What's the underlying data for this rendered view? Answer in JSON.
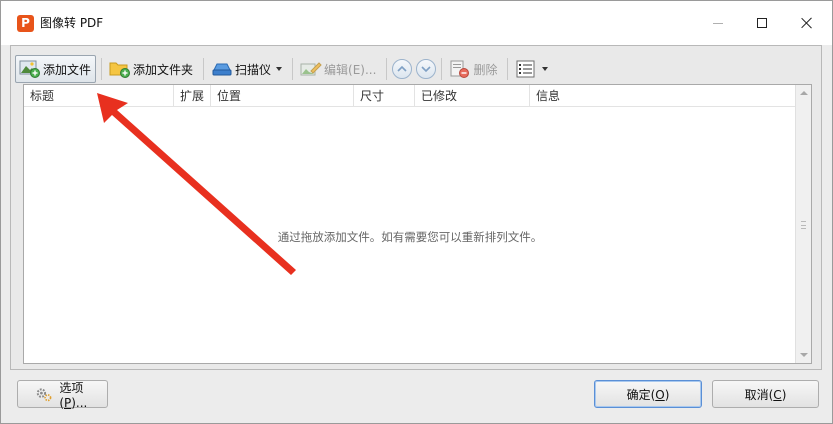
{
  "window": {
    "title": "图像转 PDF",
    "logo_letter": "P",
    "colors": {
      "logo": "#e8541a",
      "annotation_arrow": "#e8301f",
      "primary_border": "#5a8fd6"
    }
  },
  "toolbar": {
    "add_file": "添加文件",
    "add_folder": "添加文件夹",
    "scanner": "扫描仪",
    "edit": "编辑(E)...",
    "move_up_icon": "chevron-up-icon",
    "move_down_icon": "chevron-down-icon",
    "delete": "删除",
    "view_icon": "list-view-icon"
  },
  "list": {
    "columns": [
      "标题",
      "扩展",
      "位置",
      "尺寸",
      "已修改",
      "信息"
    ],
    "empty_message": "通过拖放添加文件。如有需要您可以重新排列文件。"
  },
  "buttons": {
    "options_prefix": "选项(",
    "options_key": "P",
    "options_suffix": ")...",
    "ok_prefix": "确定(",
    "ok_key": "O",
    "ok_suffix": ")",
    "cancel_prefix": "取消(",
    "cancel_key": "C",
    "cancel_suffix": ")"
  }
}
